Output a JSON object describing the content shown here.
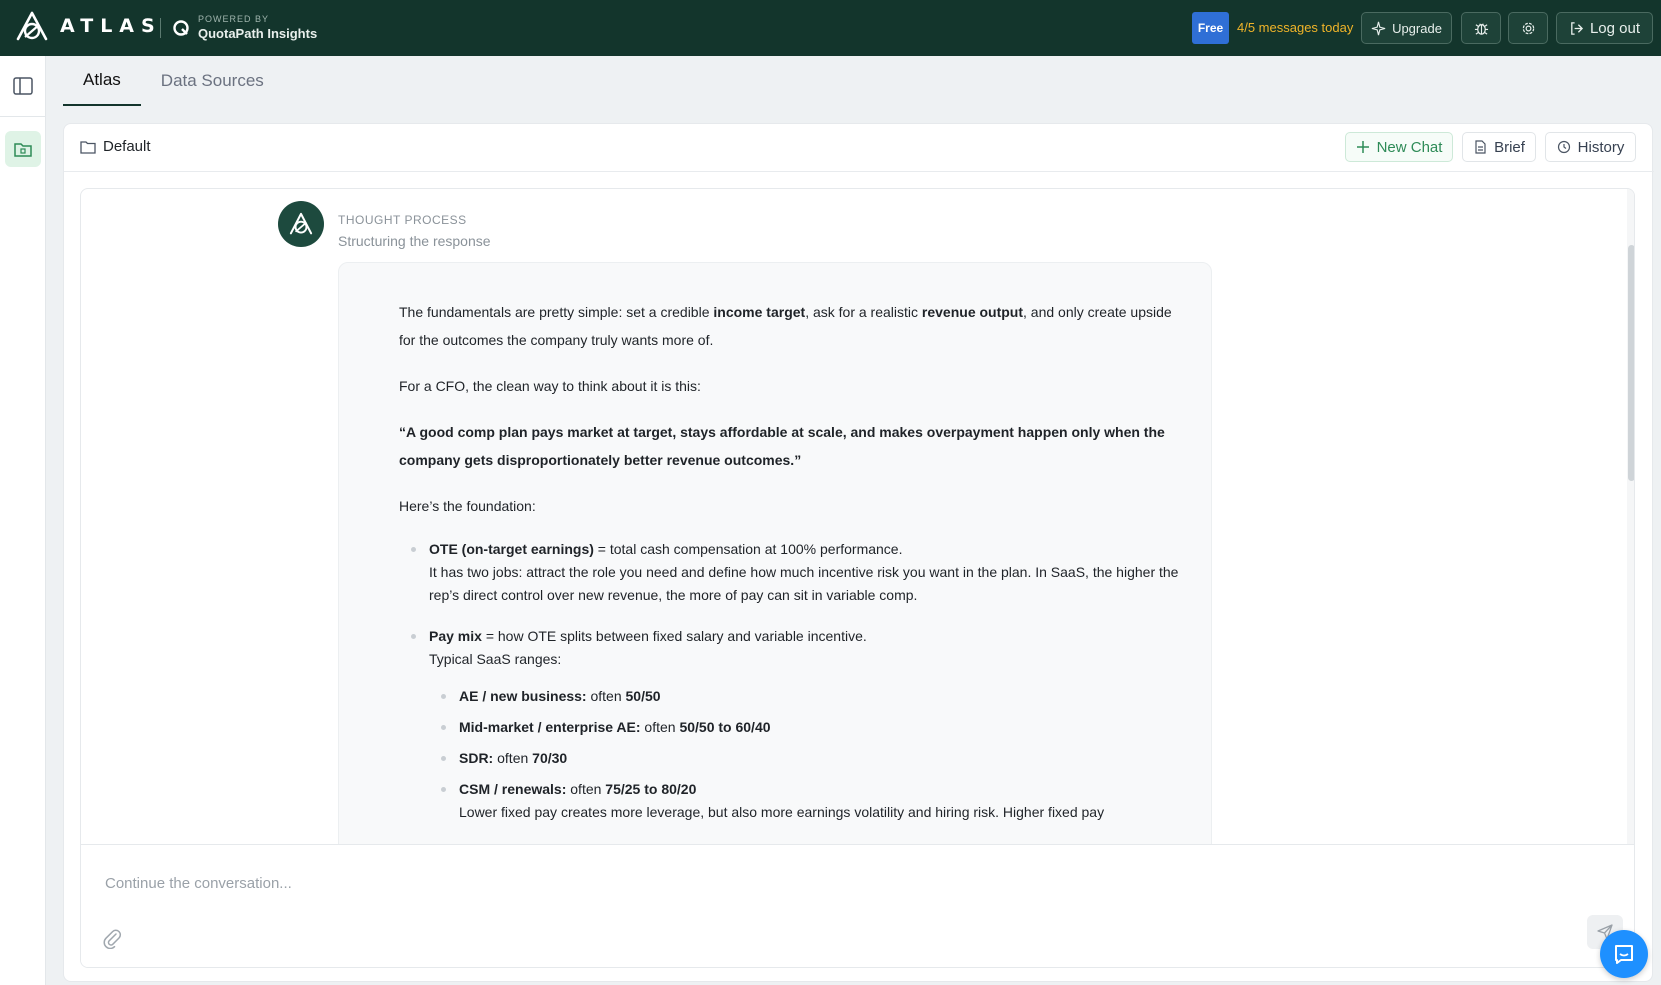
{
  "header": {
    "brand": "ATLAS",
    "powered_by": "POWERED BY",
    "powered_name": "QuotaPath Insights",
    "plan_badge": "Free",
    "message_count": "4/5 messages today",
    "upgrade_label": "Upgrade",
    "logout_label": "Log out"
  },
  "tabs": [
    {
      "label": "Atlas",
      "active": true
    },
    {
      "label": "Data Sources",
      "active": false
    }
  ],
  "workspace": {
    "folder": "Default",
    "new_chat_label": "New Chat",
    "brief_label": "Brief",
    "history_label": "History"
  },
  "thought": {
    "label": "THOUGHT PROCESS",
    "status": "Structuring the response"
  },
  "message": {
    "p1_a": "The fundamentals are pretty simple: set a credible ",
    "p1_b": "income target",
    "p1_c": ", ask for a realistic ",
    "p1_d": "revenue output",
    "p1_e": ", and only create upside for the outcomes the company truly wants more of.",
    "p2": "For a CFO, the clean way to think about it is this:",
    "quote": "“A good comp plan pays market at target, stays affordable at scale, and makes overpayment happen only when the company gets disproportionately better revenue outcomes.”",
    "p3": "Here’s the foundation:",
    "b1_term": "OTE (on-target earnings)",
    "b1_def": " = total cash compensation at 100% performance.",
    "b1_detail": "It has two jobs: attract the role you need and define how much incentive risk you want in the plan. In SaaS, the higher the rep’s direct control over new revenue, the more of pay can sit in variable comp.",
    "b2_term": "Pay mix",
    "b2_def": " = how OTE splits between fixed salary and variable incentive.",
    "b2_detail": "Typical SaaS ranges:",
    "mixes": [
      {
        "role": "AE / new business:",
        "prefix": " often ",
        "value": "50/50"
      },
      {
        "role": "Mid-market / enterprise AE:",
        "prefix": " often ",
        "value": "50/50 to 60/40"
      },
      {
        "role": "SDR:",
        "prefix": " often ",
        "value": "70/30"
      },
      {
        "role": "CSM / renewals:",
        "prefix": " often ",
        "value": "75/25 to 80/20"
      }
    ],
    "tail": "Lower fixed pay creates more leverage, but also more earnings volatility and hiring risk. Higher fixed pay"
  },
  "composer": {
    "placeholder": "Continue the conversation..."
  },
  "colors": {
    "topbar": "#13352c",
    "accent_green": "#2e8b57",
    "badge_blue": "#2f6fd6",
    "count_amber": "#f0b429"
  },
  "icons": [
    "atlas-logo-icon",
    "quotapath-icon",
    "sparkle-icon",
    "bug-icon",
    "gear-icon",
    "logout-icon",
    "sidebar-toggle-icon",
    "folder-icon",
    "plus-icon",
    "document-icon",
    "history-icon",
    "paperclip-icon",
    "send-icon",
    "chat-icon"
  ]
}
